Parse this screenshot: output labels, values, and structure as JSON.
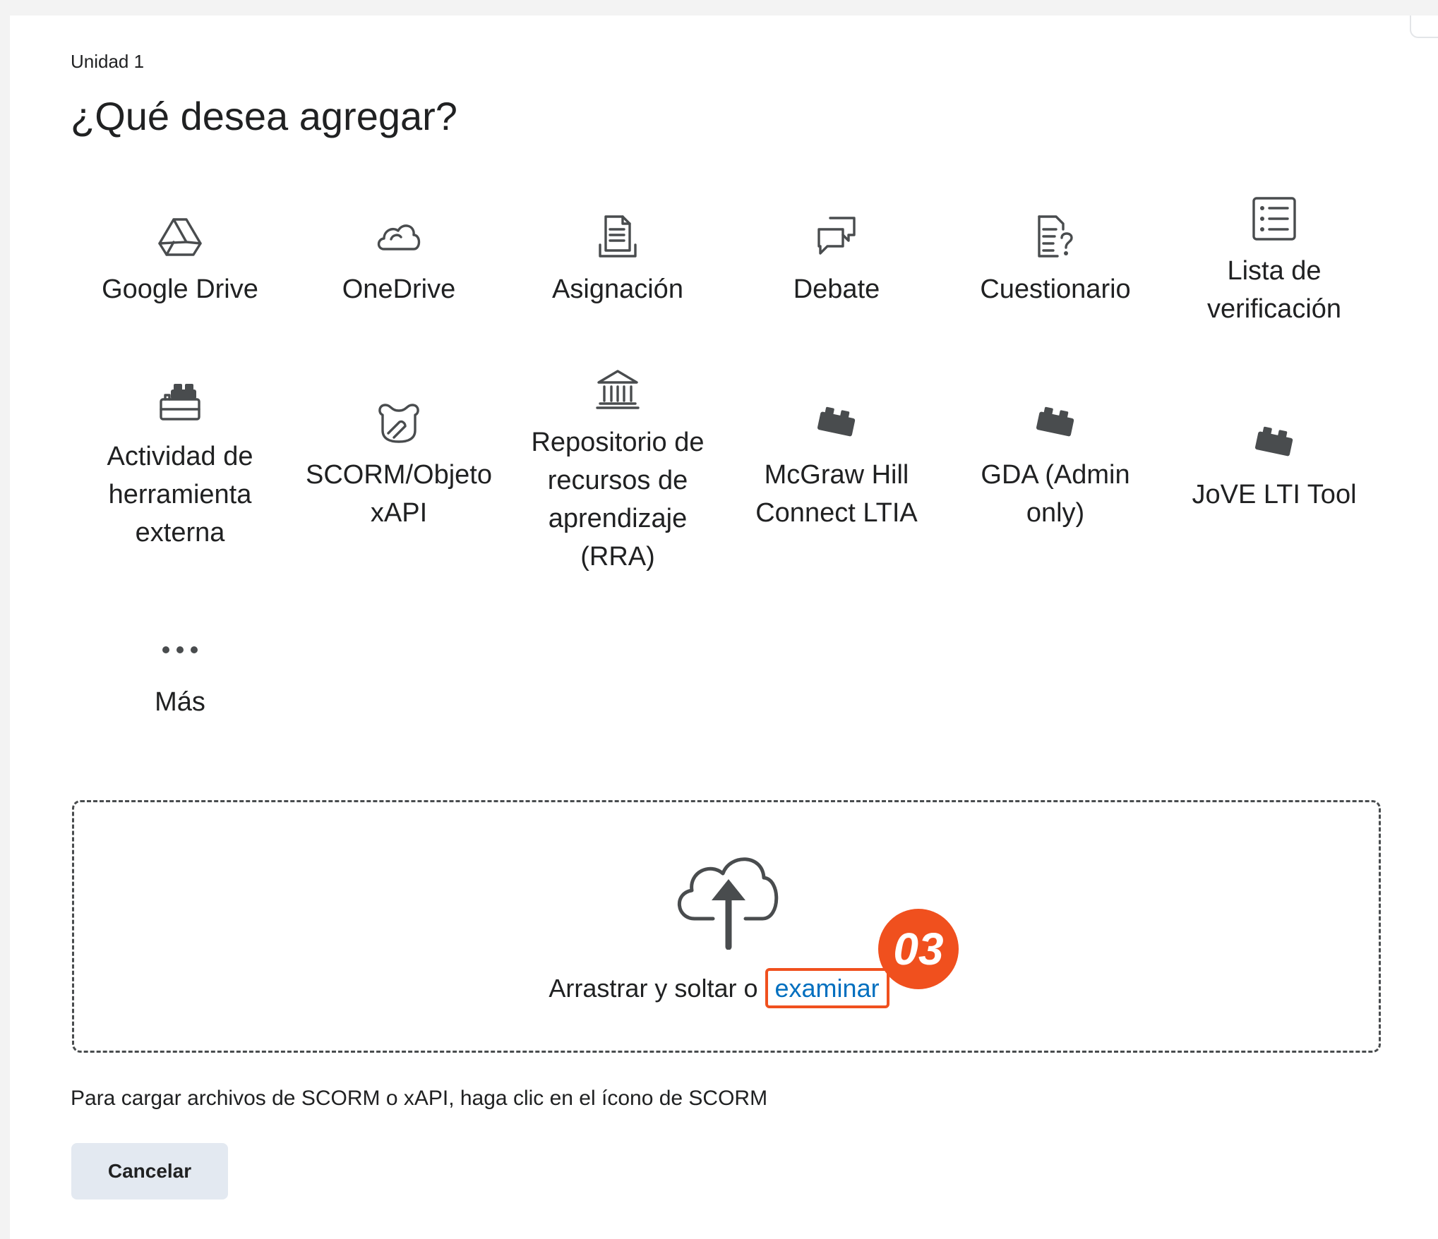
{
  "dialog": {
    "breadcrumb": "Unidad 1",
    "title": "¿Qué desea agregar?"
  },
  "tiles": [
    {
      "label": "Google Drive",
      "icon": "google-drive-icon"
    },
    {
      "label": "OneDrive",
      "icon": "onedrive-cloud-icon"
    },
    {
      "label": "Asignación",
      "icon": "assignment-document-icon"
    },
    {
      "label": "Debate",
      "icon": "discussion-bubbles-icon"
    },
    {
      "label": "Cuestionario",
      "icon": "quiz-icon"
    },
    {
      "label": "Lista de verificación",
      "icon": "checklist-icon"
    },
    {
      "label": "Actividad de herramienta externa",
      "icon": "external-tool-block-icon"
    },
    {
      "label": "SCORM/Objeto xAPI",
      "icon": "scorm-icon"
    },
    {
      "label": "Repositorio de recursos de aprendizaje (RRA)",
      "icon": "repository-building-icon"
    },
    {
      "label": "McGraw Hill Connect LTIA",
      "icon": "lti-block-icon"
    },
    {
      "label": "GDA (Admin only)",
      "icon": "lti-block-icon"
    },
    {
      "label": "JoVE LTI Tool",
      "icon": "lti-block-icon"
    },
    {
      "label": "Más",
      "icon": "more-dots-icon"
    }
  ],
  "dropzone": {
    "icon": "upload-cloud-icon",
    "text": "Arrastrar y soltar o",
    "browse_label": "examinar",
    "step_badge": "03"
  },
  "hint": "Para cargar archivos de SCORM o xAPI, haga clic en el ícono de SCORM",
  "buttons": {
    "cancel": "Cancelar"
  },
  "colors": {
    "link": "#006fbf",
    "highlight": "#f0501e",
    "icon": "#494c4e",
    "button_bg": "#e3e9f1"
  }
}
